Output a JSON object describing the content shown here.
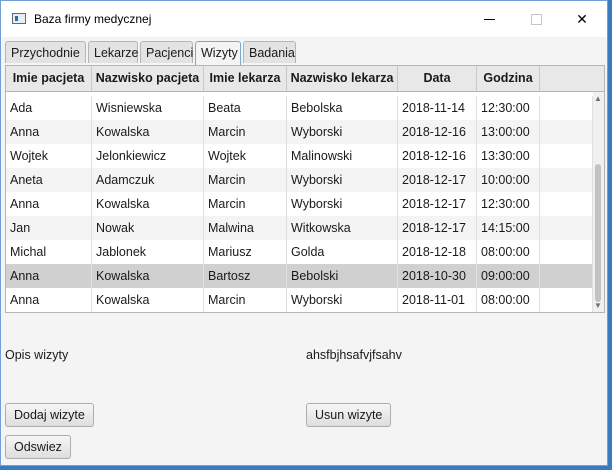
{
  "window": {
    "title": "Baza firmy medycznej"
  },
  "tabs": [
    "Przychodnie",
    "Lekarze",
    "Pacjenci",
    "Wizyty",
    "Badania"
  ],
  "table": {
    "columns": [
      "Imie pacjeta",
      "Nazwisko pacjeta",
      "Imie lekarza",
      "Nazwisko lekarza",
      "Data",
      "Godzina"
    ],
    "rows": [
      [
        "Ada",
        "Wisniewska",
        "Beata",
        "Bebolska",
        "2018-11-14",
        "12:30:00"
      ],
      [
        "Anna",
        "Kowalska",
        "Marcin",
        "Wyborski",
        "2018-12-16",
        "13:00:00"
      ],
      [
        "Wojtek",
        "Jelonkiewicz",
        "Wojtek",
        "Malinowski",
        "2018-12-16",
        "13:30:00"
      ],
      [
        "Aneta",
        "Adamczuk",
        "Marcin",
        "Wyborski",
        "2018-12-17",
        "10:00:00"
      ],
      [
        "Anna",
        "Kowalska",
        "Marcin",
        "Wyborski",
        "2018-12-17",
        "12:30:00"
      ],
      [
        "Jan",
        "Nowak",
        "Malwina",
        "Witkowska",
        "2018-12-17",
        "14:15:00"
      ],
      [
        "Michal",
        "Jablonek",
        "Mariusz",
        "Golda",
        "2018-12-18",
        "08:00:00"
      ],
      [
        "Anna",
        "Kowalska",
        "Bartosz",
        "Bebolski",
        "2018-10-30",
        "09:00:00"
      ],
      [
        "Anna",
        "Kowalska",
        "Marcin",
        "Wyborski",
        "2018-11-01",
        "08:00:00"
      ]
    ],
    "selected_row": 7
  },
  "details": {
    "opis_label": "Opis wizyty",
    "opis_value": "ahsfbjhsafvjfsahv"
  },
  "buttons": {
    "add": "Dodaj wizyte",
    "remove": "Usun wizyte",
    "refresh": "Odswiez"
  }
}
